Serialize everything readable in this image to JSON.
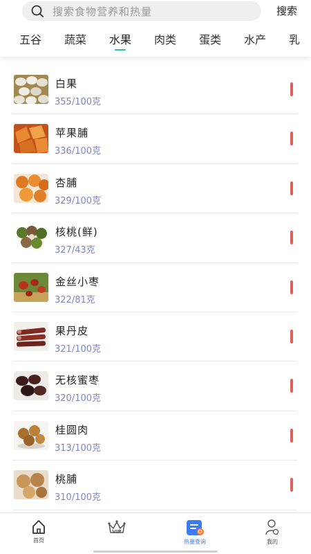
{
  "search": {
    "placeholder": "搜索食物营养和热量",
    "button_label": "搜索"
  },
  "tabs": [
    {
      "label": "五谷"
    },
    {
      "label": "蔬菜"
    },
    {
      "label": "水果"
    },
    {
      "label": "肉类"
    },
    {
      "label": "蛋类"
    },
    {
      "label": "水产"
    },
    {
      "label": "乳"
    }
  ],
  "active_tab": "水果",
  "foods": [
    {
      "name": "白果",
      "calories": "355/100克"
    },
    {
      "name": "苹果脯",
      "calories": "336/100克"
    },
    {
      "name": "杏脯",
      "calories": "329/100克"
    },
    {
      "name": "核桃(鲜)",
      "calories": "327/43克"
    },
    {
      "name": "金丝小枣",
      "calories": "322/81克"
    },
    {
      "name": "果丹皮",
      "calories": "321/100克"
    },
    {
      "name": "无核蜜枣",
      "calories": "320/100克"
    },
    {
      "name": "桂圆肉",
      "calories": "313/100克"
    },
    {
      "name": "桃脯",
      "calories": "310/100克"
    }
  ],
  "bottom_nav": [
    {
      "label": "首页",
      "icon": "home-icon"
    },
    {
      "label": "VIP",
      "icon": "crown-icon"
    },
    {
      "label": "热量查询",
      "icon": "calorie-search-icon"
    },
    {
      "label": "我的",
      "icon": "profile-icon"
    }
  ],
  "colors": {
    "accent": "#2fbf9b",
    "calorie_text": "#7f87c8",
    "level_bar": "#e0615c",
    "nav_active": "#3d7cf0"
  }
}
